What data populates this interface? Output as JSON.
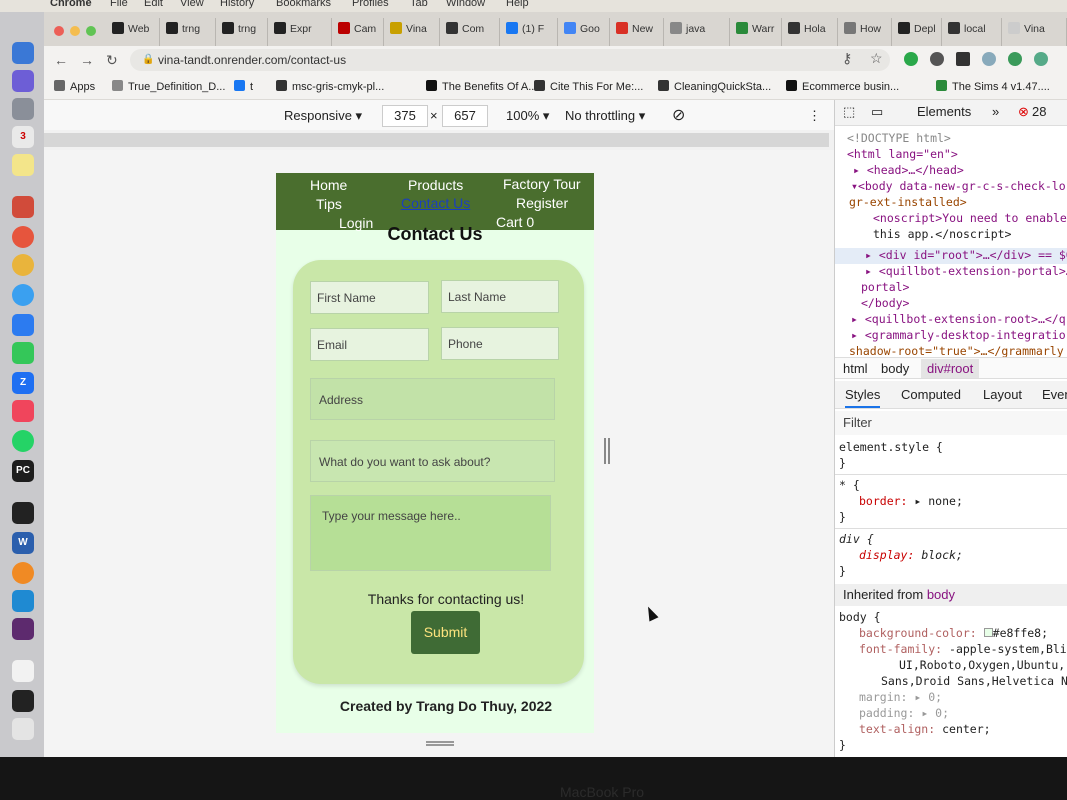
{
  "menubar": {
    "app": "Chrome",
    "items": [
      "File",
      "Edit",
      "View",
      "History",
      "Bookmarks",
      "Profiles",
      "Tab",
      "Window",
      "Help"
    ]
  },
  "tabs": [
    {
      "label": "Web",
      "icon": "notion-icon",
      "color": "#222"
    },
    {
      "label": "trng",
      "icon": "github-icon",
      "color": "#222"
    },
    {
      "label": "trng",
      "icon": "github-icon",
      "color": "#222"
    },
    {
      "label": "Expr",
      "icon": "notion-icon",
      "color": "#222"
    },
    {
      "label": "Cam",
      "icon": "cambridge-icon",
      "color": "#b00"
    },
    {
      "label": "Vina",
      "icon": "y-icon",
      "color": "#c8a000"
    },
    {
      "label": "Com",
      "icon": "globe-icon",
      "color": "#333"
    },
    {
      "label": "(1) F",
      "icon": "facebook-icon",
      "color": "#1877f2"
    },
    {
      "label": "Goo",
      "icon": "google-docs-icon",
      "color": "#4285f4"
    },
    {
      "label": "New",
      "icon": "gmail-icon",
      "color": "#d93025"
    },
    {
      "label": "java",
      "icon": "slash-icon",
      "color": "#888"
    },
    {
      "label": "Warr",
      "icon": "sheet-icon",
      "color": "#2a8a3a"
    },
    {
      "label": "Hola",
      "icon": "globe-icon",
      "color": "#333"
    },
    {
      "label": "How",
      "icon": "link-icon",
      "color": "#777"
    },
    {
      "label": "Depl",
      "icon": "render-icon",
      "color": "#222"
    },
    {
      "label": "local",
      "icon": "globe-icon",
      "color": "#333"
    },
    {
      "label": "Vina",
      "icon": "loading-icon",
      "color": "#ccc"
    }
  ],
  "toolbar": {
    "url": "vina-tandt.onrender.com/contact-us"
  },
  "bookmarks": [
    {
      "label": "Apps",
      "icon": "apps-grid-icon",
      "color": "#666"
    },
    {
      "label": "True_Definition_D...",
      "icon": "file-icon",
      "color": "#888"
    },
    {
      "label": "t",
      "icon": "facebook-icon",
      "color": "#1877f2"
    },
    {
      "label": "msc-gris-cmyk-pl...",
      "icon": "globe-icon",
      "color": "#333"
    },
    {
      "label": "The Benefits Of A...",
      "icon": "forbes-icon",
      "color": "#111"
    },
    {
      "label": "Cite This For Me:...",
      "icon": "globe-icon",
      "color": "#333"
    },
    {
      "label": "CleaningQuickSta...",
      "icon": "globe-icon",
      "color": "#333"
    },
    {
      "label": "Ecommerce busin...",
      "icon": "amazon-icon",
      "color": "#111"
    },
    {
      "label": "The Sims 4 v1.47....",
      "icon": "sims-icon",
      "color": "#2a8a3a"
    }
  ],
  "device_toolbar": {
    "device": "Responsive",
    "width": "375",
    "times": "×",
    "height": "657",
    "zoom": "100%",
    "throttling": "No throttling"
  },
  "site": {
    "nav": [
      "Home",
      "Products",
      "Factory Tour",
      "Tips",
      "Contact Us",
      "Register",
      "Login",
      "Cart 0"
    ],
    "active_nav": "Contact Us",
    "title": "Contact Us",
    "fields": {
      "first_name": "First Name",
      "last_name": "Last Name",
      "email": "Email",
      "phone": "Phone",
      "address": "Address",
      "subject": "What do you want to ask about?",
      "message": "Type your message here.."
    },
    "thanks": "Thanks for contacting us!",
    "submit": "Submit",
    "footer": "Created by Trang Do Thuy, 2022",
    "colors": {
      "nav_bg": "#4a6e2e",
      "page_bg": "#e8ffe8",
      "card_bg": "#c9e7a8",
      "submit_bg": "#3f6b35",
      "submit_text": "#fde37e"
    }
  },
  "devtools": {
    "tabs": {
      "elements": "Elements",
      "more": "»",
      "errors": "28"
    },
    "dom": {
      "doctype": "<!DOCTYPE html>",
      "html_open": "<html lang=\"en\">",
      "head": "<head>…</head>",
      "body_open": "<body data-new-gr-c-s-check-lo",
      "body_cont": "gr-ext-installed>",
      "noscript1": "<noscript>You need to enable",
      "noscript2": "this app.</noscript>",
      "root_div": "<div id=\"root\">…</div> == $0",
      "quillbot": "<quillbot-extension-portal>…",
      "portal": "portal>",
      "body_close": "</body>",
      "quillbot_root": "<quillbot-extension-root>…</q",
      "grammarly": "<grammarly-desktop-integratio",
      "shadow": "shadow-root=\"true\">…</grammarly"
    },
    "breadcrumbs": [
      "html",
      "body",
      "div#root"
    ],
    "style_tabs": [
      "Styles",
      "Computed",
      "Layout",
      "Even"
    ],
    "filter": "Filter",
    "rules": {
      "element_style": "element.style {",
      "close": "}",
      "star": "* {",
      "border_prop": "border:",
      "border_val": "▸ none;",
      "div": "div {",
      "display_prop": "display:",
      "display_val": "block;",
      "inherited_label": "Inherited from",
      "inherited_from": "body",
      "body_rule": "body {",
      "bg_prop": "background-color:",
      "bg_val": "#e8ffe8;",
      "ff_prop": "font-family:",
      "ff_val1": "-apple-system,Bli",
      "ff_val2": "UI,Roboto,Oxygen,Ubuntu,",
      "ff_val3": "Sans,Droid Sans,Helvetica N",
      "margin_prop": "margin:",
      "margin_val": "▸ 0;",
      "padding_prop": "padding:",
      "padding_val": "▸ 0;",
      "ta_prop": "text-align:",
      "ta_val": "center;"
    }
  },
  "device_label": "MacBook Pro"
}
